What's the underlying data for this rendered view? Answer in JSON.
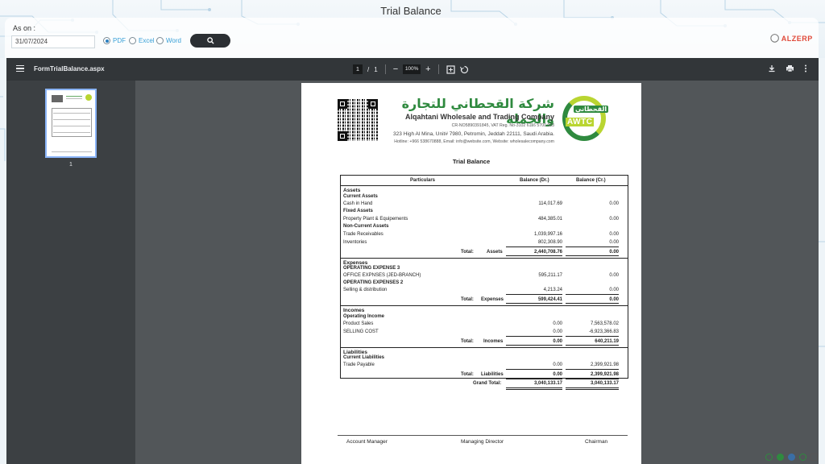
{
  "page": {
    "title": "Trial Balance"
  },
  "filter": {
    "as_on_label": "As on :",
    "date_value": "31/07/2024",
    "formats": [
      {
        "label": "PDF",
        "selected": true
      },
      {
        "label": "Excel",
        "selected": false
      },
      {
        "label": "Word",
        "selected": false
      }
    ],
    "search_icon": "search-icon"
  },
  "brand": {
    "logo_text": "ALZERP"
  },
  "viewer": {
    "file_name": "FormTrialBalance.aspx",
    "current_page": "1",
    "page_sep": "/",
    "total_pages": "1",
    "zoom": "100%",
    "thumb_label": "1"
  },
  "document": {
    "company_ar": "شركة القحطاني للتجارة والجملة",
    "company_en": "Alqahtani Wholesale and Trading Company",
    "cr_vat": "CR-NO5890391845, VAT Reg. No-3102 6116 5700 003",
    "address": "323 High Al Mina, Unit# 7980, Petromin, Jeddah 22111, Saudi Arabia.",
    "contact": "Hotline: +966 538670888, Email: info@website.com, Website: wholesalecompany.com",
    "logo_ar": "القحطاني",
    "logo_en": "AWTC",
    "report_title": "Trial Balance",
    "columns": {
      "particulars": "Particulars",
      "dr": "Balance (Dr.)",
      "cr": "Balance (Cr.)"
    },
    "sections": {
      "assets": {
        "heading": "Assets",
        "current": "Current Assets",
        "cash": {
          "name": "Cash in Hand",
          "dr": "114,017.69",
          "cr": "0.00"
        },
        "fixed": "Fixed Assets",
        "ppe": {
          "name": "Property Plant & Equipements",
          "dr": "484,385.01",
          "cr": "0.00"
        },
        "noncurrent": "Non-Current Assets",
        "trade_rec": {
          "name": "Trade Receivables",
          "dr": "1,039,997.16",
          "cr": "0.00"
        },
        "inventories": {
          "name": "Inventories",
          "dr": "802,308.90",
          "cr": "0.00"
        },
        "total_label": "Total:",
        "total_name": "Assets",
        "total_dr": "2,440,708.76",
        "total_cr": "0.00"
      },
      "expenses": {
        "heading": "Expenses",
        "op3": "OPERATING EXPENSE 3",
        "office": {
          "name": "OFFICE EXPNSES (JED-BRANCH)",
          "dr": "595,211.17",
          "cr": "0.00"
        },
        "op2": "OPERATING EXPENSES 2",
        "selling": {
          "name": "Selling & distribution",
          "dr": "4,213.24",
          "cr": "0.00"
        },
        "total_label": "Total:",
        "total_name": "Expenses",
        "total_dr": "599,424.41",
        "total_cr": "0.00"
      },
      "incomes": {
        "heading": "Incomes",
        "operating": "Operating Income",
        "sales": {
          "name": "Product Sales",
          "dr": "0.00",
          "cr": "7,563,578.02"
        },
        "cost": {
          "name": "SELLING COST",
          "dr": "0.00",
          "cr": "-6,923,366.83"
        },
        "total_label": "Total:",
        "total_name": "Incomes",
        "total_dr": "0.00",
        "total_cr": "640,211.19"
      },
      "liabilities": {
        "heading": "Liabilities",
        "current": "Current Liabilities",
        "payable": {
          "name": "Trade Payable",
          "dr": "0.00",
          "cr": "2,399,921.98"
        },
        "total_label": "Total:",
        "total_name": "Liabilities",
        "total_dr": "0.00",
        "total_cr": "2,399,921.98"
      }
    },
    "grand_total": {
      "label": "Grand Total:",
      "dr": "3,040,133.17",
      "cr": "3,040,133.17"
    },
    "signatures": {
      "account_manager": "Account Manager",
      "managing_director": "Managing Director",
      "chairman": "Chairman"
    }
  }
}
